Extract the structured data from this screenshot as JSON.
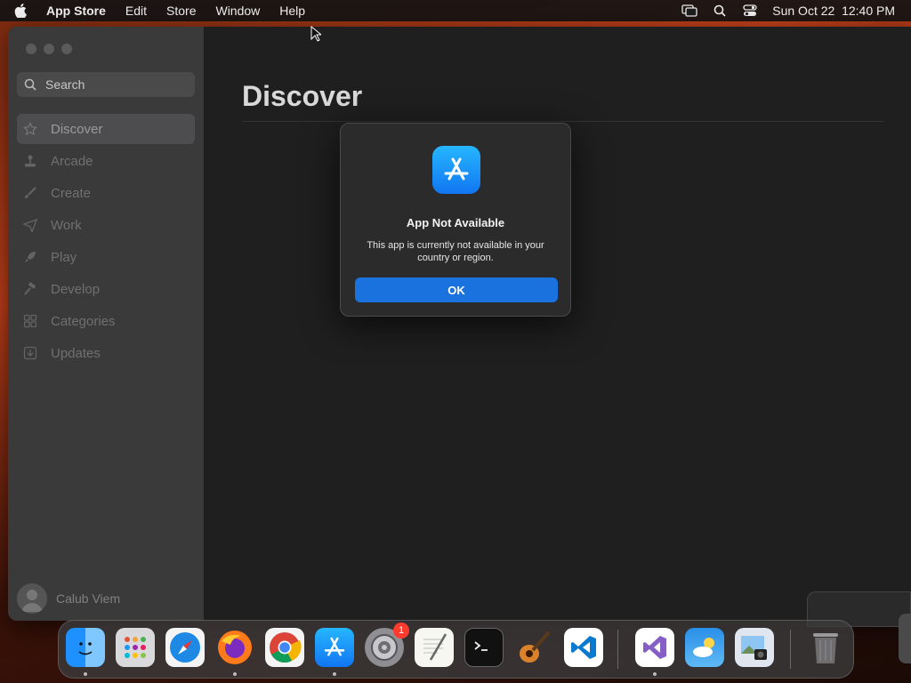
{
  "menubar": {
    "app_name": "App Store",
    "items": [
      "Edit",
      "Store",
      "Window",
      "Help"
    ],
    "datetime": "Sun Oct 22  12:40 PM"
  },
  "sidebar": {
    "search_placeholder": "Search",
    "items": [
      {
        "label": "Discover",
        "icon": "star-icon",
        "active": true
      },
      {
        "label": "Arcade",
        "icon": "joystick-icon"
      },
      {
        "label": "Create",
        "icon": "brush-icon"
      },
      {
        "label": "Work",
        "icon": "paper-plane-icon"
      },
      {
        "label": "Play",
        "icon": "rocket-icon"
      },
      {
        "label": "Develop",
        "icon": "hammer-icon"
      },
      {
        "label": "Categories",
        "icon": "grid-icon"
      },
      {
        "label": "Updates",
        "icon": "download-icon"
      }
    ],
    "user_name": "Calub Viem"
  },
  "main": {
    "title": "Discover"
  },
  "dialog": {
    "title": "App Not Available",
    "message": "This app is currently not available in your country or region.",
    "ok_label": "OK"
  },
  "dock": {
    "apps": [
      "Finder",
      "Launchpad",
      "Safari",
      "Firefox",
      "Chrome",
      "App Store",
      "System Settings",
      "TextEdit",
      "Terminal",
      "GarageBand",
      "VS Code",
      "Visual Studio",
      "Weather",
      "Preview",
      "Trash"
    ],
    "settings_badge": "1"
  },
  "colors": {
    "accent": "#1a72de",
    "badge": "#ff3b30"
  }
}
